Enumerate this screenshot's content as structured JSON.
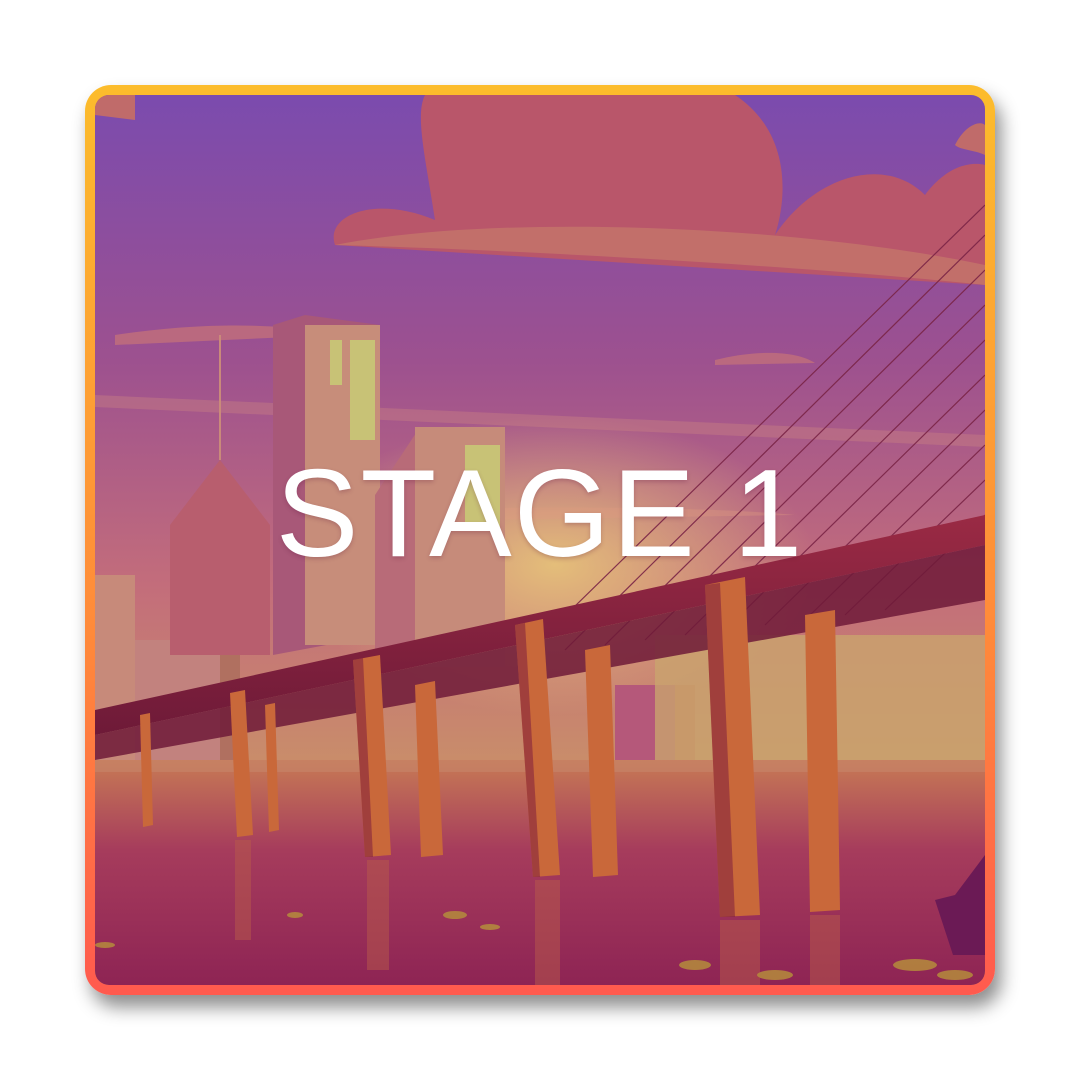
{
  "stage": {
    "title": "STAGE 1",
    "border_gradient": [
      "#fcbc2c",
      "#ff8a3a",
      "#ff5a4e"
    ],
    "title_color": "#ffffff"
  },
  "artwork": {
    "sky_colors": [
      "#7b4bae",
      "#9d518f",
      "#c36d7b",
      "#c98d6a"
    ],
    "water_colors": [
      "#c77a55",
      "#a63c5c",
      "#8e2454"
    ],
    "bridge_color": "#7e1e3e",
    "pillar_color": "#c9683a"
  }
}
